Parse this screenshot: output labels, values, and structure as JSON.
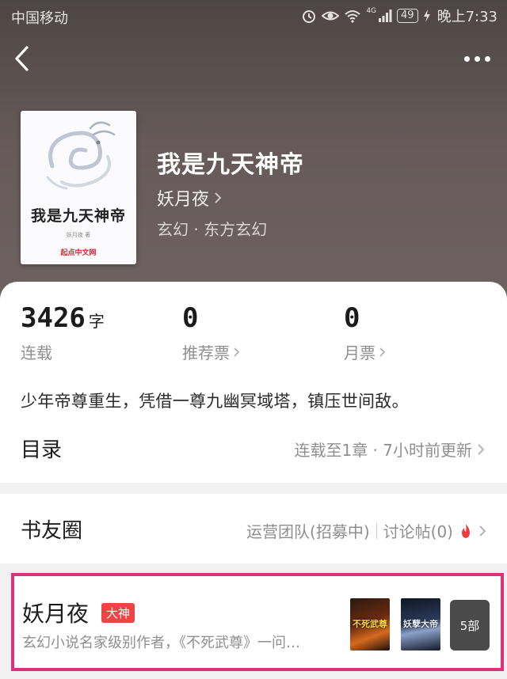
{
  "status_bar": {
    "carrier": "中国移动",
    "network": "4G",
    "battery": "49",
    "time": "晚上7:33"
  },
  "book": {
    "title": "我是九天神帝",
    "author": "妖月夜",
    "genre": "玄幻 · 东方玄幻",
    "cover": {
      "title": "我是九天神帝",
      "author_line": "妖月夜 著",
      "brand": "起点中文网"
    }
  },
  "stats": {
    "words_value": "3426",
    "words_unit": "字",
    "words_label": "连载",
    "recommend_value": "0",
    "recommend_label": "推荐票",
    "monthly_value": "0",
    "monthly_label": "月票"
  },
  "synopsis": "少年帝尊重生，凭借一尊九幽冥域塔，镇压世间敌。",
  "toc": {
    "title": "目录",
    "info": "连载至1章 · 7小时前更新"
  },
  "circle": {
    "title": "书友圈",
    "team": "运营团队(招募中)",
    "forum": "讨论帖(0)"
  },
  "author_card": {
    "name": "妖月夜",
    "badge": "大神",
    "description": "玄幻小说名家级别作者，《不死武尊》一问…",
    "book1_text": "不死武尊",
    "book2_text": "妖孽大帝",
    "more": "5部"
  },
  "colors": {
    "header_bg": "#5d5352",
    "highlight_border": "#d8347a",
    "badge_bg": "#f04444",
    "hot_icon": "#ee3b3b"
  }
}
